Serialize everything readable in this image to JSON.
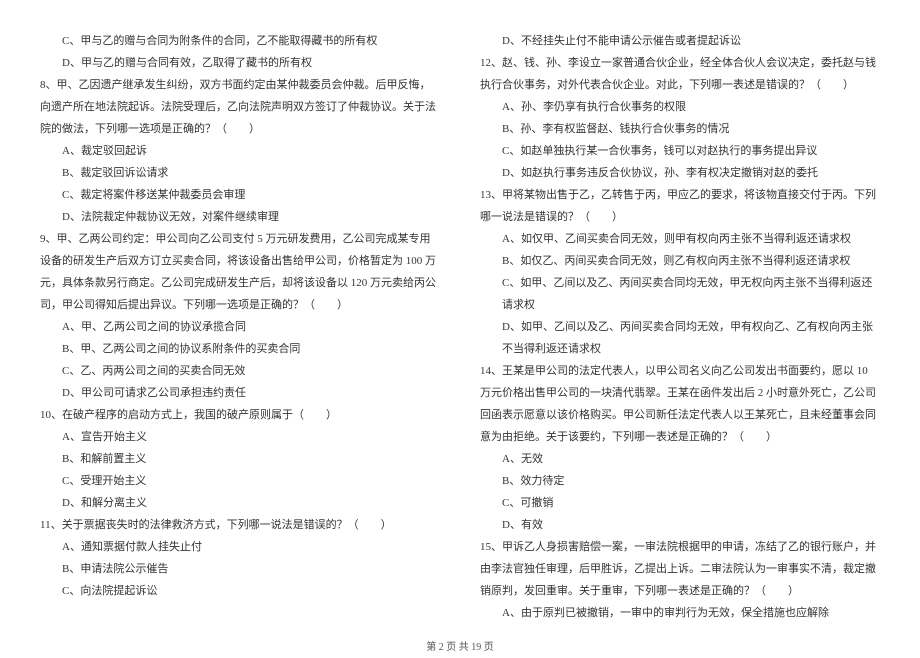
{
  "left": {
    "q7cd": [
      "C、甲与乙的赠与合同为附条件的合同，乙不能取得藏书的所有权",
      "D、甲与乙的赠与合同有效，乙取得了藏书的所有权"
    ],
    "q8": {
      "stem": "8、甲、乙因遗产继承发生纠纷，双方书面约定由某仲裁委员会仲裁。后甲反悔，向遗产所在地法院起诉。法院受理后，乙向法院声明双方签订了仲裁协议。关于法院的做法，下列哪一选项是正确的？（　　）",
      "opts": [
        "A、裁定驳回起诉",
        "B、裁定驳回诉讼请求",
        "C、裁定将案件移送某仲裁委员会审理",
        "D、法院裁定仲裁协议无效，对案件继续审理"
      ]
    },
    "q9": {
      "stem": "9、甲、乙两公司约定：甲公司向乙公司支付 5 万元研发费用，乙公司完成某专用设备的研发生产后双方订立买卖合同，将该设备出售给甲公司，价格暂定为 100 万元，具体条款另行商定。乙公司完成研发生产后，却将该设备以 120 万元卖给丙公司，甲公司得知后提出异议。下列哪一选项是正确的？（　　）",
      "opts": [
        "A、甲、乙两公司之间的协议承揽合同",
        "B、甲、乙两公司之间的协议系附条件的买卖合同",
        "C、乙、丙两公司之间的买卖合同无效",
        "D、甲公司可请求乙公司承担违约责任"
      ]
    },
    "q10": {
      "stem": "10、在破产程序的启动方式上，我国的破产原则属于（　　）",
      "opts": [
        "A、宣告开始主义",
        "B、和解前置主义",
        "C、受理开始主义",
        "D、和解分离主义"
      ]
    },
    "q11": {
      "stem": "11、关于票据丧失时的法律救济方式，下列哪一说法是错误的？（　　）",
      "opts": [
        "A、通知票据付款人挂失止付",
        "B、申请法院公示催告",
        "C、向法院提起诉讼"
      ]
    }
  },
  "right": {
    "q11d": "D、不经挂失止付不能申请公示催告或者提起诉讼",
    "q12": {
      "stem": "12、赵、钱、孙、李设立一家普通合伙企业，经全体合伙人会议决定，委托赵与钱执行合伙事务，对外代表合伙企业。对此，下列哪一表述是错误的？（　　）",
      "opts": [
        "A、孙、李仍享有执行合伙事务的权限",
        "B、孙、李有权监督赵、钱执行合伙事务的情况",
        "C、如赵单独执行某一合伙事务，钱可以对赵执行的事务提出异议",
        "D、如赵执行事务违反合伙协议，孙、李有权决定撤销对赵的委托"
      ]
    },
    "q13": {
      "stem": "13、甲将某物出售于乙，乙转售于丙，甲应乙的要求，将该物直接交付于丙。下列哪一说法是错误的？（　　）",
      "opts": [
        "A、如仅甲、乙间买卖合同无效，则甲有权向丙主张不当得利返还请求权",
        "B、如仅乙、丙间买卖合同无效，则乙有权向丙主张不当得利返还请求权",
        "C、如甲、乙间以及乙、丙间买卖合同均无效，甲无权向丙主张不当得利返还请求权",
        "D、如甲、乙间以及乙、丙间买卖合同均无效，甲有权向乙、乙有权向丙主张不当得利返还请求权"
      ]
    },
    "q14": {
      "stem": "14、王某是甲公司的法定代表人，以甲公司名义向乙公司发出书面要约，愿以 10 万元价格出售甲公司的一块清代翡翠。王某在函件发出后 2 小时意外死亡，乙公司回函表示愿意以该价格购买。甲公司新任法定代表人以王某死亡，且未经董事会同意为由拒绝。关于该要约，下列哪一表述是正确的？（　　）",
      "opts": [
        "A、无效",
        "B、效力待定",
        "C、可撤销",
        "D、有效"
      ]
    },
    "q15": {
      "stem": "15、甲诉乙人身损害赔偿一案，一审法院根据甲的申请，冻结了乙的银行账户，并由李法官独任审理，后甲胜诉，乙提出上诉。二审法院认为一审事实不清，裁定撤销原判，发回重审。关于重审，下列哪一表述是正确的？（　　）",
      "optA": "A、由于原判已被撤销，一审中的审判行为无效，保全措施也应解除"
    }
  },
  "footer": "第 2 页 共 19 页"
}
